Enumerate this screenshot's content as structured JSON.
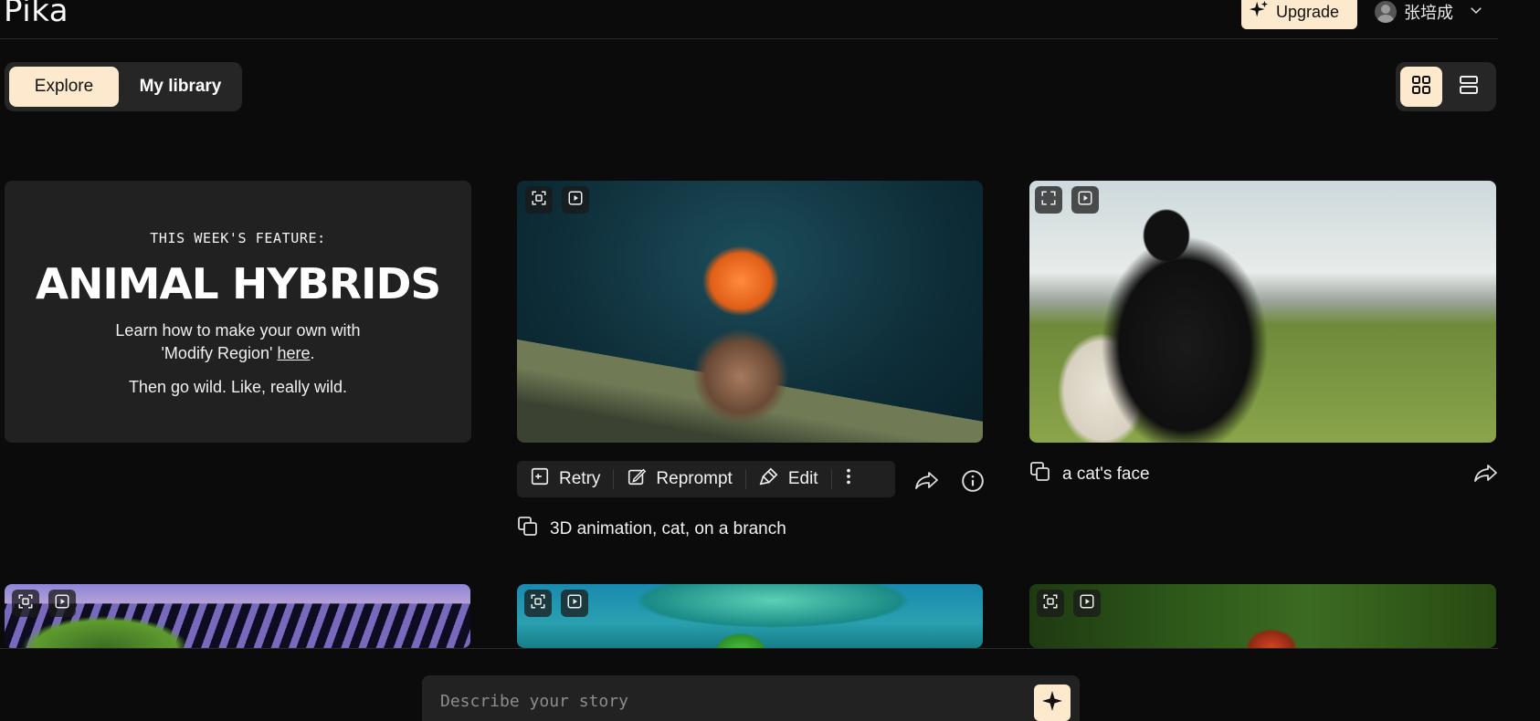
{
  "header": {
    "logo": "Pika",
    "upgrade_label": "Upgrade",
    "user_name": "张培成"
  },
  "tabs": [
    {
      "label": "Explore",
      "active": true
    },
    {
      "label": "My library",
      "active": false
    }
  ],
  "view_toggle": {
    "grid_icon": "grid-view-icon",
    "list_icon": "list-view-icon",
    "active": "grid"
  },
  "feature": {
    "kicker": "THIS WEEK'S FEATURE:",
    "headline": "ANIMAL HYBRIDS",
    "desc_line1": "Learn how to make your own with",
    "desc_line2_prefix": "'Modify Region' ",
    "desc_link": "here",
    "desc_line2_suffix": ".",
    "tail": "Then go wild. Like, really wild."
  },
  "actions": {
    "retry": "Retry",
    "reprompt": "Reprompt",
    "edit": "Edit"
  },
  "videos": [
    {
      "prompt": "3D animation, cat, on a branch"
    },
    {
      "prompt": "a cat's face"
    }
  ],
  "story": {
    "placeholder": "Describe your story"
  },
  "colors": {
    "background": "#0b0b0b",
    "accent": "#fde9cd",
    "panel": "#262626"
  }
}
